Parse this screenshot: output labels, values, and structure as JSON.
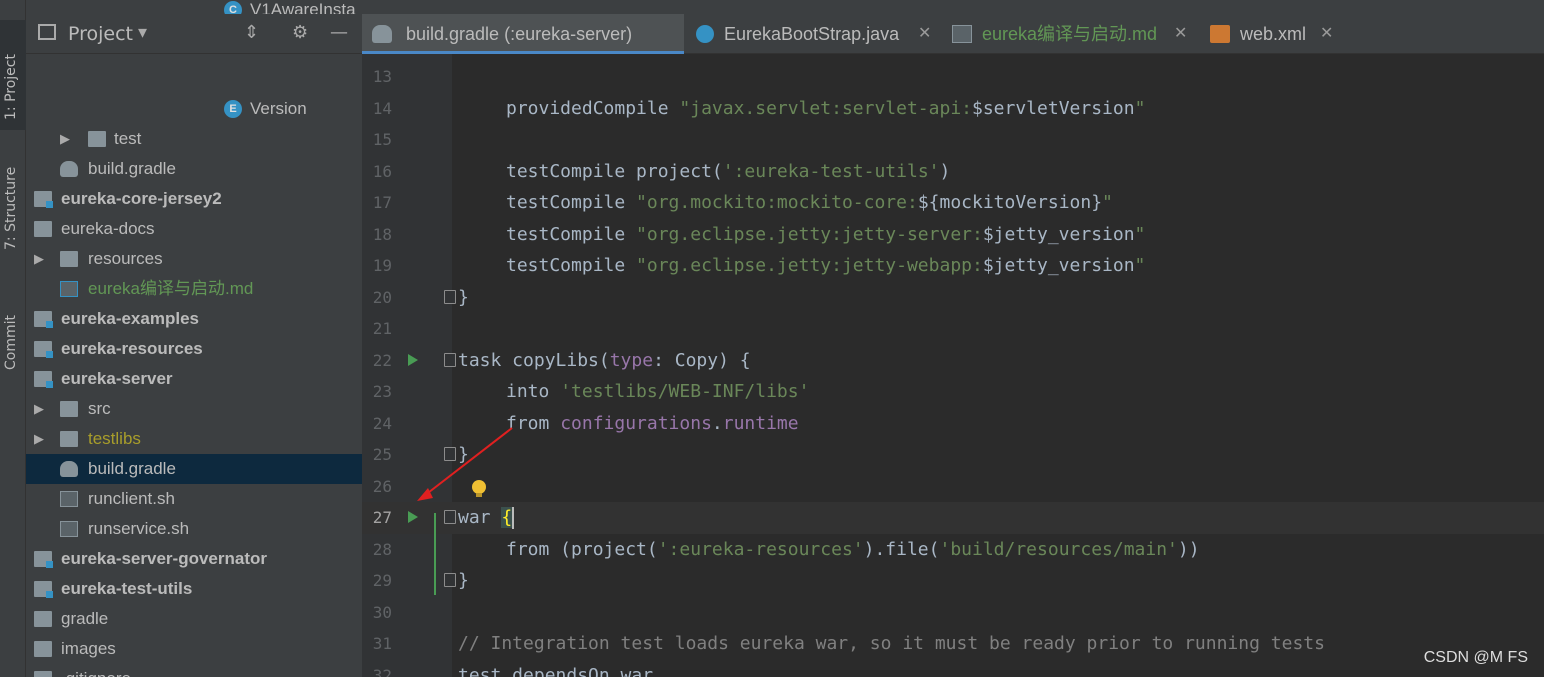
{
  "toolstrip": {
    "tabs": [
      {
        "label": "1: Project"
      },
      {
        "label": "7: Structure"
      },
      {
        "label": "Commit"
      }
    ]
  },
  "project_panel": {
    "title": "Project",
    "tree": [
      {
        "label": "V1AwareInsta",
        "icon": "class-icon",
        "type": "class"
      },
      {
        "label": "Version",
        "icon": "enum-icon",
        "type": "enum"
      },
      {
        "label": "test",
        "icon": "folder-icon",
        "type": "folder"
      },
      {
        "label": "build.gradle",
        "icon": "gradle-icon",
        "type": "file"
      },
      {
        "label": "eureka-core-jersey2",
        "icon": "module-folder-icon",
        "type": "module"
      },
      {
        "label": "eureka-docs",
        "icon": "folder-icon",
        "type": "folder"
      },
      {
        "label": "resources",
        "icon": "folder-icon",
        "type": "folder"
      },
      {
        "label": "eureka编译与启动.md",
        "icon": "markdown-icon",
        "type": "md"
      },
      {
        "label": "eureka-examples",
        "icon": "module-folder-icon",
        "type": "module"
      },
      {
        "label": "eureka-resources",
        "icon": "module-folder-icon",
        "type": "module"
      },
      {
        "label": "eureka-server",
        "icon": "module-folder-icon",
        "type": "module"
      },
      {
        "label": "src",
        "icon": "folder-icon",
        "type": "folder"
      },
      {
        "label": "testlibs",
        "icon": "folder-icon",
        "type": "folder"
      },
      {
        "label": "build.gradle",
        "icon": "gradle-icon",
        "type": "file"
      },
      {
        "label": "runclient.sh",
        "icon": "shell-icon",
        "type": "file"
      },
      {
        "label": "runservice.sh",
        "icon": "shell-icon",
        "type": "file"
      },
      {
        "label": "eureka-server-governator",
        "icon": "module-folder-icon",
        "type": "module"
      },
      {
        "label": "eureka-test-utils",
        "icon": "module-folder-icon",
        "type": "module"
      },
      {
        "label": "gradle",
        "icon": "folder-icon",
        "type": "folder"
      },
      {
        "label": "images",
        "icon": "folder-icon",
        "type": "folder"
      },
      {
        "label": ".gitignore",
        "icon": "file-icon",
        "type": "file"
      }
    ]
  },
  "tabs": [
    {
      "label": "build.gradle (:eureka-server)",
      "icon": "gradle-icon",
      "active": true
    },
    {
      "label": "EurekaBootStrap.java",
      "icon": "class-icon",
      "active": false
    },
    {
      "label": "eureka编译与启动.md",
      "icon": "markdown-icon",
      "active": false
    },
    {
      "label": "web.xml",
      "icon": "xml-icon",
      "active": false
    }
  ],
  "editor": {
    "line_numbers": [
      "13",
      "14",
      "15",
      "16",
      "17",
      "18",
      "19",
      "20",
      "21",
      "22",
      "23",
      "24",
      "25",
      "26",
      "27",
      "28",
      "29",
      "30",
      "31",
      "32"
    ],
    "current_line": "27",
    "lines": {
      "l14": {
        "a": "providedCompile ",
        "b": "\"javax.servlet:servlet-api:",
        "c": "$servletVersion",
        "d": "\""
      },
      "l16": {
        "a": "testCompile project(",
        "b": "':eureka-test-utils'",
        "c": ")"
      },
      "l17": {
        "a": "testCompile ",
        "b": "\"org.mockito:mockito-core:",
        "c": "${mockitoVersion}",
        "d": "\""
      },
      "l18": {
        "a": "testCompile ",
        "b": "\"org.eclipse.jetty:jetty-server:",
        "c": "$jetty_version",
        "d": "\""
      },
      "l19": {
        "a": "testCompile ",
        "b": "\"org.eclipse.jetty:jetty-webapp:",
        "c": "$jetty_version",
        "d": "\""
      },
      "l20": {
        "a": "}"
      },
      "l22": {
        "a": "task copyLibs(",
        "b": "type",
        "c": ": Copy) {"
      },
      "l23": {
        "a": "into ",
        "b": "'testlibs/WEB-INF/libs'"
      },
      "l24": {
        "a": "from ",
        "b": "configurations",
        "c": ".",
        "d": "runtime"
      },
      "l25": {
        "a": "}"
      },
      "l27": {
        "a": "war ",
        "b": "{"
      },
      "l28": {
        "a": "from (project(",
        "b": "':eureka-resources'",
        "c": ").file(",
        "d": "'build/resources/main'",
        "e": "))"
      },
      "l29": {
        "a": "}"
      },
      "l31": {
        "a": "// Integration test loads eureka war, so it must be ready prior to running tests"
      },
      "l32": {
        "a": "test.dependsOn war"
      }
    }
  },
  "watermark": "CSDN @M FS",
  "colors": {
    "background": "#2b2b2b",
    "panel": "#3c3f41",
    "keyword": "#cc7832",
    "string": "#6a8759",
    "property": "#9876aa",
    "annotation_arrow": "#e02020"
  }
}
